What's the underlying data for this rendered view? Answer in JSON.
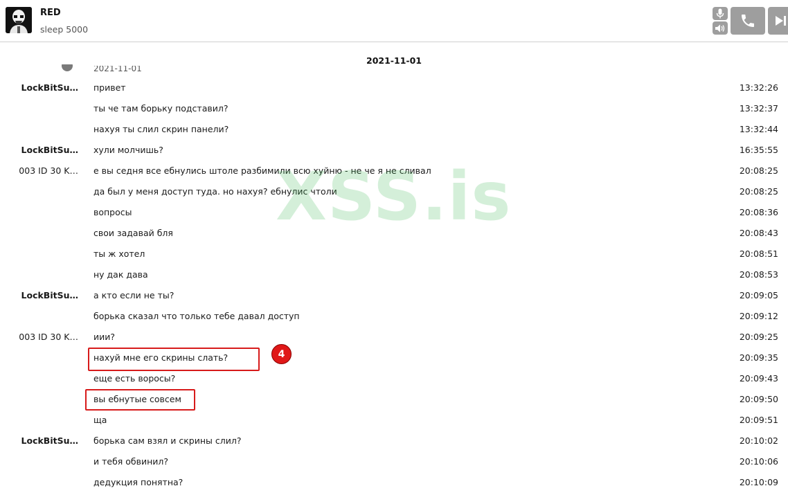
{
  "header": {
    "contact_name": "RED",
    "contact_status": "sleep 5000"
  },
  "chat": {
    "date_separator": "2021-11-01",
    "messages": [
      {
        "sender": "LockBitSu…",
        "sender_bold": true,
        "text": "привет",
        "time": "13:32:26"
      },
      {
        "sender": "",
        "sender_bold": false,
        "text": "ты че там борьку подставил?",
        "time": "13:32:37"
      },
      {
        "sender": "",
        "sender_bold": false,
        "text": "нахуя ты слил скрин панели?",
        "time": "13:32:44"
      },
      {
        "sender": "LockBitSu…",
        "sender_bold": true,
        "text": "хули молчишь?",
        "time": "16:35:55"
      },
      {
        "sender": "003 ID 30 K…",
        "sender_bold": false,
        "text": "е вы седня все ебнулись штоле разбимили всю хуйню - не че я не сливал",
        "time": "20:08:25"
      },
      {
        "sender": "",
        "sender_bold": false,
        "text": "да был у меня доступ туда. но нахуя? ебнулис чтоли",
        "time": "20:08:25"
      },
      {
        "sender": "",
        "sender_bold": false,
        "text": "вопросы",
        "time": "20:08:36"
      },
      {
        "sender": "",
        "sender_bold": false,
        "text": "свои задавай бля",
        "time": "20:08:43"
      },
      {
        "sender": "",
        "sender_bold": false,
        "text": "ты ж хотел",
        "time": "20:08:51"
      },
      {
        "sender": "",
        "sender_bold": false,
        "text": "ну дак дава",
        "time": "20:08:53"
      },
      {
        "sender": "LockBitSu…",
        "sender_bold": true,
        "text": "а кто если не ты?",
        "time": "20:09:05"
      },
      {
        "sender": "",
        "sender_bold": false,
        "text": "борька сказал что только тебе давал доступ",
        "time": "20:09:12"
      },
      {
        "sender": "003 ID 30 K…",
        "sender_bold": false,
        "text": "иии?",
        "time": "20:09:25"
      },
      {
        "sender": "",
        "sender_bold": false,
        "text": "нахуй мне его скрины слать?",
        "time": "20:09:35"
      },
      {
        "sender": "",
        "sender_bold": false,
        "text": "еще есть воросы?",
        "time": "20:09:43"
      },
      {
        "sender": "",
        "sender_bold": false,
        "text": "вы ебнутые совсем",
        "time": "20:09:50"
      },
      {
        "sender": "",
        "sender_bold": false,
        "text": "ща",
        "time": "20:09:51"
      },
      {
        "sender": "LockBitSu…",
        "sender_bold": true,
        "text": "борька сам взял и скрины слил?",
        "time": "20:10:02"
      },
      {
        "sender": "",
        "sender_bold": false,
        "text": "и тебя обвинил?",
        "time": "20:10:06"
      },
      {
        "sender": "",
        "sender_bold": false,
        "text": "дедукция понятна?",
        "time": "20:10:09"
      }
    ]
  },
  "overlay": {
    "watermark": "XSS.is",
    "badge_number": "4"
  },
  "colors": {
    "highlight": "#d71a1a",
    "badge": "#e01818",
    "watermark": "rgba(60,180,80,0.22)",
    "control_button": "#9e9e9e"
  },
  "icons": [
    "stormtrooper-avatar",
    "microphone-icon",
    "speaker-icon",
    "phone-icon",
    "video-play-icon",
    "info-icon"
  ]
}
